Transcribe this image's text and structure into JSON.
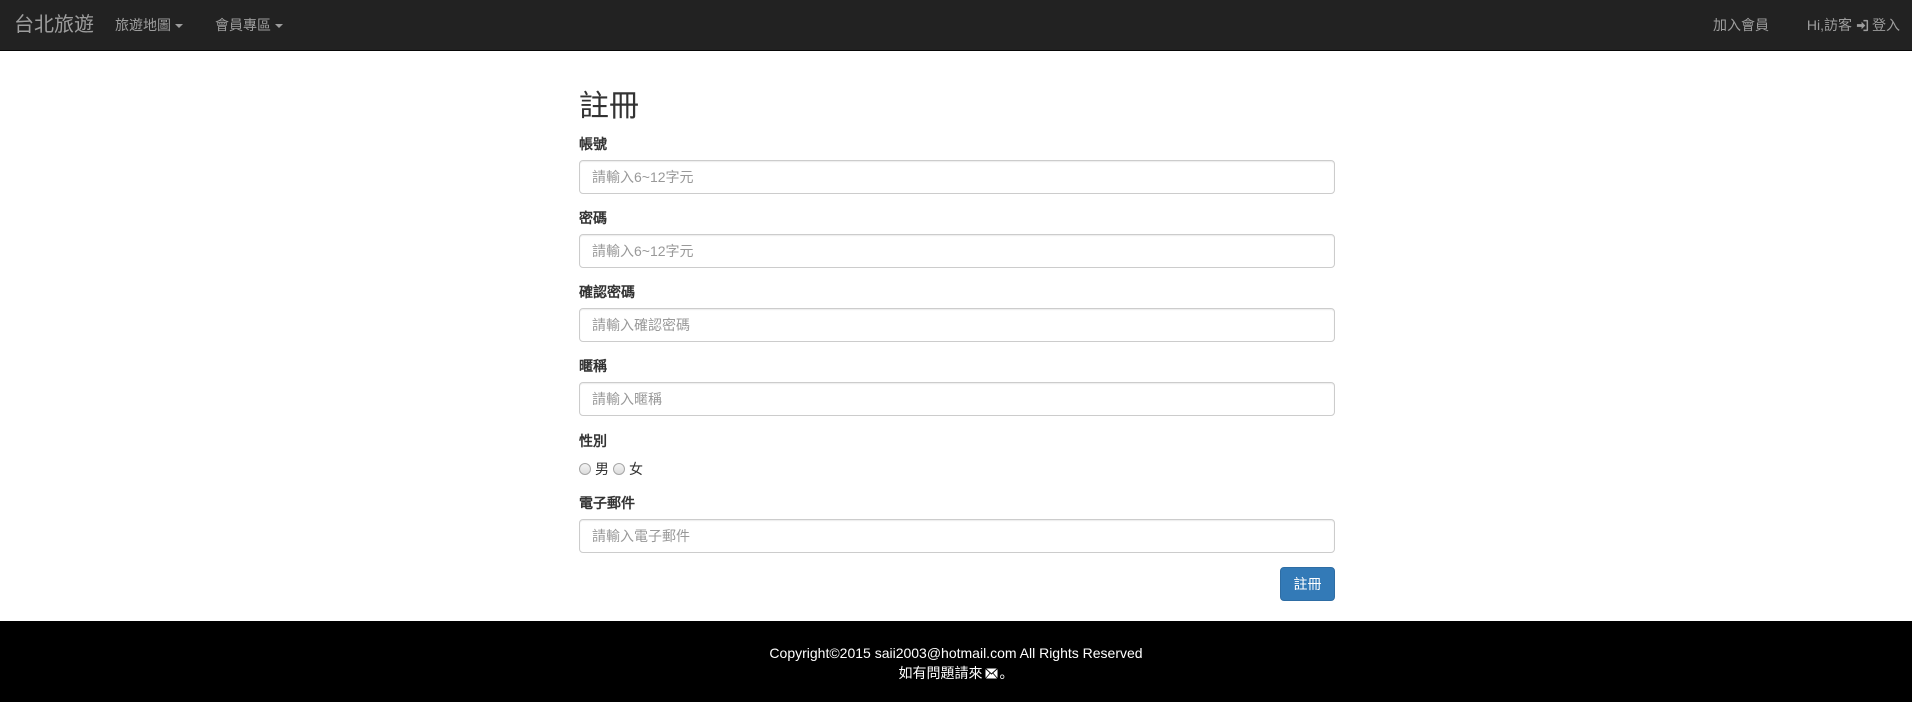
{
  "navbar": {
    "brand": "台北旅遊",
    "items": [
      {
        "label": "旅遊地圖"
      },
      {
        "label": "會員專區"
      }
    ],
    "join_label": "加入會員",
    "greeting": "Hi,訪客",
    "login_label": "登入"
  },
  "form": {
    "title": "註冊",
    "account": {
      "label": "帳號",
      "placeholder": "請輸入6~12字元"
    },
    "password": {
      "label": "密碼",
      "placeholder": "請輸入6~12字元"
    },
    "confirm": {
      "label": "確認密碼",
      "placeholder": "請輸入確認密碼"
    },
    "nickname": {
      "label": "暱稱",
      "placeholder": "請輸入暱稱"
    },
    "gender": {
      "label": "性別",
      "options": [
        "男",
        "女"
      ]
    },
    "email": {
      "label": "電子郵件",
      "placeholder": "請輸入電子郵件"
    },
    "submit_label": "註冊"
  },
  "footer": {
    "copyright": "Copyright©2015 saii2003@hotmail.com All Rights Reserved",
    "contact_prefix": "如有問題請來",
    "contact_suffix": "。"
  },
  "colors": {
    "navbar_bg": "#222222",
    "nav_text": "#9d9d9d",
    "primary": "#337ab7",
    "footer_bg": "#000000"
  }
}
